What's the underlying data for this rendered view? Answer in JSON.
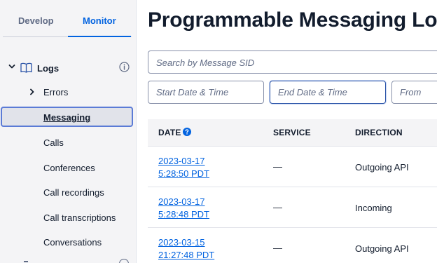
{
  "sidebar": {
    "tabs": [
      {
        "label": "Develop",
        "active": false
      },
      {
        "label": "Monitor",
        "active": true
      }
    ],
    "section": {
      "label": "Logs",
      "icon": "book-icon",
      "info_icon": "info-icon"
    },
    "items": [
      {
        "label": "Errors",
        "expandable": true
      },
      {
        "label": "Messaging",
        "active": true
      },
      {
        "label": "Calls"
      },
      {
        "label": "Conferences"
      },
      {
        "label": "Call recordings"
      },
      {
        "label": "Call transcriptions"
      },
      {
        "label": "Conversations"
      }
    ]
  },
  "main": {
    "title": "Programmable Messaging Logs",
    "search_placeholder": "Search by Message SID",
    "filters": {
      "start_placeholder": "Start Date & Time",
      "end_placeholder": "End Date & Time",
      "from_placeholder": "From"
    },
    "table": {
      "headers": {
        "date": "DATE",
        "service": "SERVICE",
        "direction": "DIRECTION"
      },
      "rows": [
        {
          "date_line1": "2023-03-17",
          "date_line2": "5:28:50 PDT",
          "service": "—",
          "direction": "Outgoing API"
        },
        {
          "date_line1": "2023-03-17",
          "date_line2": "5:28:48 PDT",
          "service": "—",
          "direction": "Incoming"
        },
        {
          "date_line1": "2023-03-15",
          "date_line2": "21:27:48 PDT",
          "service": "—",
          "direction": "Outgoing API"
        }
      ]
    }
  },
  "colors": {
    "accent": "#0263e0",
    "active_border": "#5b7bd6",
    "sidebar_bg": "#f4f4f6",
    "text": "#121c2d"
  }
}
